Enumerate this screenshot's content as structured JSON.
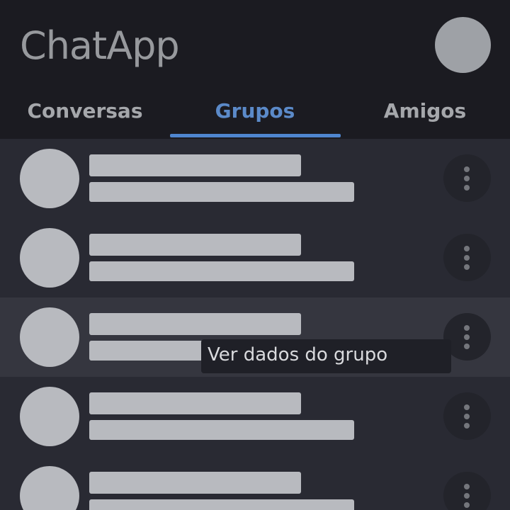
{
  "header": {
    "title": "ChatApp",
    "avatar_icon": "user-avatar-icon"
  },
  "tabs": [
    {
      "label": "Conversas",
      "active": false
    },
    {
      "label": "Grupos",
      "active": true
    },
    {
      "label": "Amigos",
      "active": false
    }
  ],
  "list": {
    "rows": [
      {
        "state": "loading",
        "menu_icon": "more-vertical-icon"
      },
      {
        "state": "loading",
        "menu_icon": "more-vertical-icon"
      },
      {
        "state": "loading",
        "hovered": true,
        "menu_icon": "more-vertical-icon"
      },
      {
        "state": "loading",
        "menu_icon": "more-vertical-icon"
      },
      {
        "state": "loading",
        "menu_icon": "more-vertical-icon"
      }
    ]
  },
  "tooltip": {
    "text": "Ver dados do grupo"
  },
  "colors": {
    "header_bg": "#1b1b21",
    "list_bg": "#292a33",
    "row_hover_bg": "#35363f",
    "accent": "#4f86cf",
    "active_tab_text": "#5b8ac9",
    "skeleton": "#b8babf",
    "tooltip_bg": "#1f2027"
  }
}
